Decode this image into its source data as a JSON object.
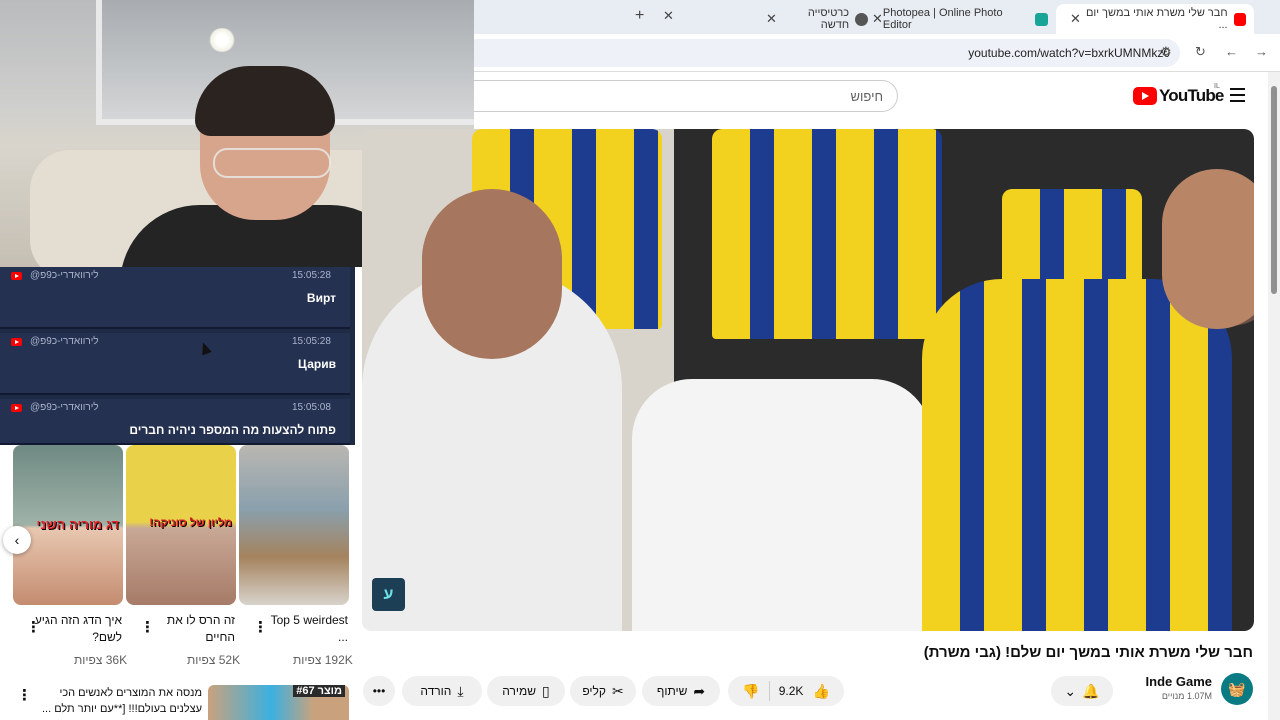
{
  "browser": {
    "tabs": [
      {
        "title": "חבר שלי משרת אותי במשך יום ...",
        "favicon": "youtube-favicon",
        "active": true
      },
      {
        "title": "Photopea | Online Photo Editor",
        "favicon": "photopea-favicon",
        "active": false
      },
      {
        "title": "כרטיסייה חדשה",
        "favicon": "chrome-favicon",
        "active": false
      }
    ],
    "new_tab": "+",
    "close": "✕",
    "url": "youtube.com/watch?v=bxrkUMNMkz0"
  },
  "masthead": {
    "logo_text": "YouTube",
    "country": "IL",
    "search_placeholder": "חיפוש"
  },
  "chat": {
    "messages": [
      {
        "user": "@לירוואדרי-כ9פ",
        "time": "15:05:28",
        "text": "Вирт"
      },
      {
        "user": "@לירוואדרי-כ9פ",
        "time": "15:05:28",
        "text": "Царив"
      },
      {
        "user": "@לירוואדרי-כ9פ",
        "time": "15:05:08",
        "text": "פתוח להצעות מה המספר ניהיה חברים"
      }
    ]
  },
  "video": {
    "title": "חבר שלי משרת אותי במשך יום שלם! (גבי משרת)",
    "watermark": "ע",
    "likes": "9.2K",
    "share": "שיתוף",
    "clip": "קליפ",
    "save": "שמירה",
    "download": "הורדה",
    "more": "•••",
    "channel": {
      "name": "Inde Game",
      "subscribers": "1.07M מנויים"
    }
  },
  "shorts": [
    {
      "title": "Top 5 weirdest ...",
      "views": "192K צפיות"
    },
    {
      "title": "זה הרס לו את החיים",
      "views": "52K צפיות"
    },
    {
      "title": "איך הדג הזה הגיע לשם?",
      "views": "36K צפיות"
    }
  ],
  "short_overlays": {
    "first": "דג מוריה השני",
    "second": "מליון של סוניקה!"
  },
  "recommendation": {
    "title": "מנסה את המוצרים לאנשים הכי עצלנים בעולם!!! [**עם יותר תלם ...",
    "thumb_label": "מוצר #67"
  },
  "colors": {
    "youtube_red": "#ff0000",
    "chat_bg": "#243151",
    "jersey_yellow": "#f2d21e",
    "jersey_blue": "#1d3b8f"
  }
}
